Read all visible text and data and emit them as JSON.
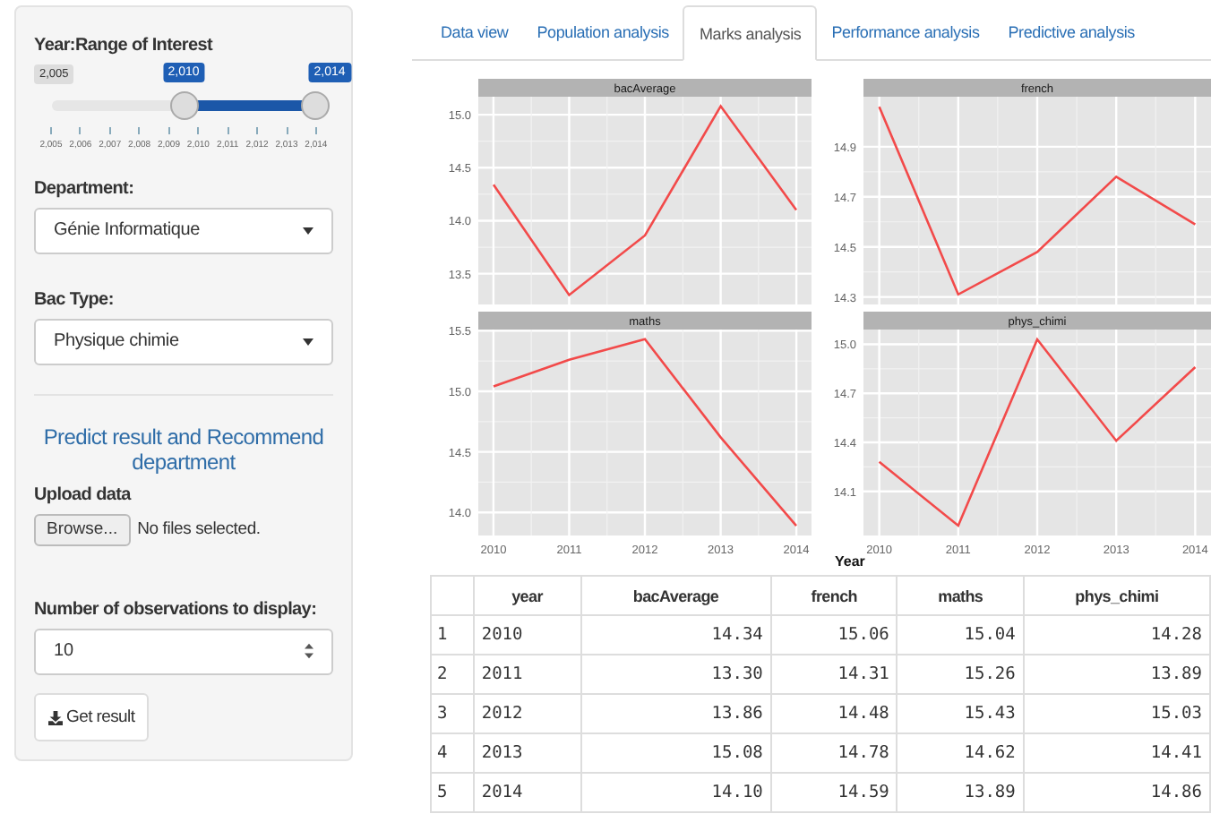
{
  "sidebar": {
    "year_range": {
      "label": "Year:Range of Interest",
      "min_label": "2,005",
      "handles": [
        {
          "label": "2,010",
          "level": 0.5
        },
        {
          "label": "2,014",
          "level": 1
        }
      ],
      "ticks": [
        "2,005",
        "2,006",
        "2,007",
        "2,008",
        "2,009",
        "2,010",
        "2,011",
        "2,012",
        "2,013",
        "2,014"
      ]
    },
    "department": {
      "label": "Department:",
      "value": "Génie Informatique"
    },
    "bac_type": {
      "label": "Bac Type:",
      "value": "Physique chimie"
    },
    "predict_heading": "Predict result and Recommend department",
    "upload": {
      "label": "Upload data",
      "button": "Browse...",
      "status": "No files selected."
    },
    "observations": {
      "label": "Number of observations to display:",
      "value": "10"
    },
    "get_result": "Get result"
  },
  "tabs": [
    {
      "label": "Data view",
      "selected": false
    },
    {
      "label": "Population analysis",
      "selected": false
    },
    {
      "label": "Marks analysis",
      "selected": true
    },
    {
      "label": "Performance analysis",
      "selected": false
    },
    {
      "label": "Predictive analysis",
      "selected": false
    }
  ],
  "facets": [
    {
      "chart_data": {
        "type": "line",
        "title": "bacAverage",
        "grid": true,
        "x": [
          2010,
          2011,
          2012,
          2013,
          2014
        ],
        "series": [
          {
            "color": "#f24a4a",
            "values": [
              14.34,
              13.3,
              13.86,
              15.08,
              14.1
            ]
          }
        ],
        "xlim": [
          2009.8,
          2014.2
        ],
        "ylim": [
          13.21,
          15.17
        ],
        "yticks": [
          {
            "value": 13.5,
            "label": "13.5"
          },
          {
            "value": 14,
            "label": "14.0"
          },
          {
            "value": 14.5,
            "label": "14.5"
          },
          {
            "value": 15,
            "label": "15.0"
          }
        ]
      }
    },
    {
      "chart_data": {
        "type": "line",
        "title": "french",
        "grid": true,
        "x": [
          2010,
          2011,
          2012,
          2013,
          2014
        ],
        "series": [
          {
            "color": "#f24a4a",
            "values": [
              15.06,
              14.31,
              14.48,
              14.78,
              14.59
            ]
          }
        ],
        "xlim": [
          2009.8,
          2014.2
        ],
        "ylim": [
          14.27,
          15.1
        ],
        "yticks": [
          {
            "value": 14.3,
            "label": "14.3"
          },
          {
            "value": 14.5,
            "label": "14.5"
          },
          {
            "value": 14.7,
            "label": "14.7"
          },
          {
            "value": 14.9,
            "label": "14.9"
          }
        ]
      }
    },
    {
      "chart_data": {
        "type": "line",
        "title": "maths",
        "grid": true,
        "x": [
          2010,
          2011,
          2012,
          2013,
          2014
        ],
        "series": [
          {
            "color": "#f24a4a",
            "values": [
              15.04,
              15.26,
              15.43,
              14.62,
              13.89
            ]
          }
        ],
        "xlim": [
          2009.8,
          2014.2
        ],
        "xticks": [
          2010,
          2011,
          2012,
          2013,
          2014
        ],
        "ylim": [
          13.81,
          15.51
        ],
        "yticks": [
          {
            "value": 14,
            "label": "14.0"
          },
          {
            "value": 14.5,
            "label": "14.5"
          },
          {
            "value": 15,
            "label": "15.0"
          },
          {
            "value": 15.5,
            "label": "15.5"
          }
        ]
      }
    },
    {
      "chart_data": {
        "type": "line",
        "title": "phys_chimi",
        "grid": true,
        "x": [
          2010,
          2011,
          2012,
          2013,
          2014
        ],
        "series": [
          {
            "color": "#f24a4a",
            "values": [
              14.28,
              13.89,
              15.03,
              14.41,
              14.86
            ]
          }
        ],
        "xlim": [
          2009.8,
          2014.2
        ],
        "xticks": [
          2010,
          2011,
          2012,
          2013,
          2014
        ],
        "ylim": [
          13.83,
          15.09
        ],
        "yticks": [
          {
            "value": 14.1,
            "label": "14.1"
          },
          {
            "value": 14.4,
            "label": "14.4"
          },
          {
            "value": 14.7,
            "label": "14.7"
          },
          {
            "value": 15,
            "label": "15.0"
          }
        ]
      }
    }
  ],
  "x_axis_title": "Year",
  "table": {
    "columns": [
      "",
      "year",
      "bacAverage",
      "french",
      "maths",
      "phys_chimi"
    ],
    "rows": [
      [
        "1",
        "2010",
        "14.34",
        "15.06",
        "15.04",
        "14.28"
      ],
      [
        "2",
        "2011",
        "13.30",
        "14.31",
        "15.26",
        "13.89"
      ],
      [
        "3",
        "2012",
        "13.86",
        "14.48",
        "15.43",
        "15.03"
      ],
      [
        "4",
        "2013",
        "15.08",
        "14.78",
        "14.62",
        "14.41"
      ],
      [
        "5",
        "2014",
        "14.10",
        "14.59",
        "13.89",
        "14.86"
      ]
    ]
  }
}
